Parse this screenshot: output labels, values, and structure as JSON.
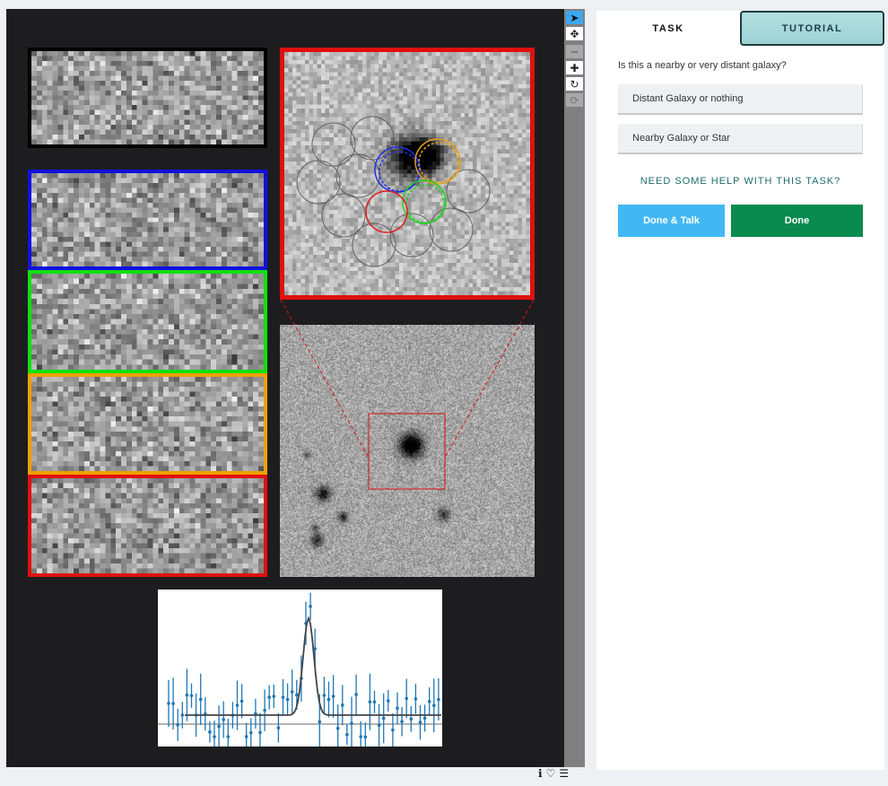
{
  "toolbar": {
    "tools": [
      {
        "name": "pointer",
        "glyph": "➤"
      },
      {
        "name": "move",
        "glyph": "✥"
      },
      {
        "name": "zoom-out",
        "glyph": "━"
      },
      {
        "name": "zoom-in",
        "glyph": "✚"
      },
      {
        "name": "rotate",
        "glyph": "↻"
      },
      {
        "name": "reset",
        "glyph": "⟳"
      }
    ]
  },
  "cutout_colors": [
    "#000000",
    "#1010e0",
    "#10e010",
    "#f0a000",
    "#e01010"
  ],
  "aperture_colors": {
    "blue": "#2030e0",
    "orange": "#e0a020",
    "green": "#20d020",
    "red": "#e02020",
    "gray": "#555555"
  },
  "spectrum": {
    "line_color": "#1f77b4",
    "fit_color": "#444444"
  },
  "task_panel": {
    "tabs": {
      "task": "TASK",
      "tutorial": "TUTORIAL"
    },
    "question": "Is this a nearby or very distant galaxy?",
    "answers": [
      "Distant Galaxy or nothing",
      "Nearby Galaxy or Star"
    ],
    "help_link": "NEED SOME HELP WITH THIS TASK?",
    "done_talk": "Done & Talk",
    "done": "Done"
  },
  "footer_icons": [
    "info-icon",
    "heart-icon",
    "collections-icon"
  ]
}
